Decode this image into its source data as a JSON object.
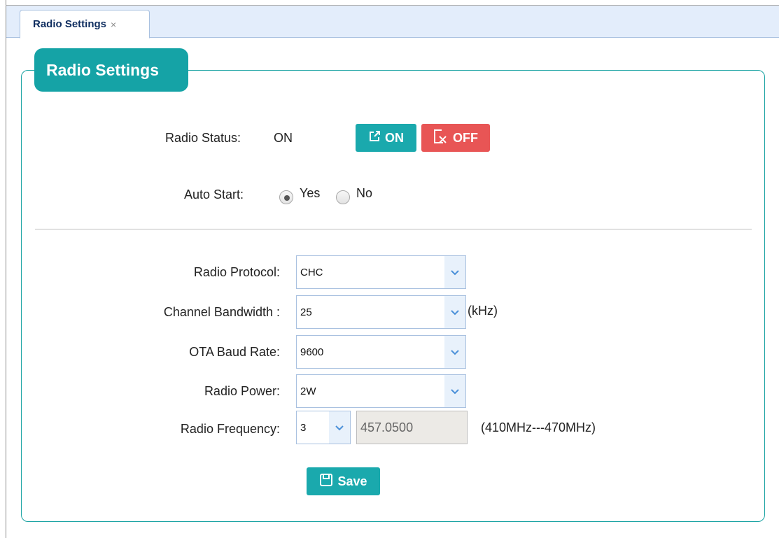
{
  "tab": {
    "title": "Radio Settings",
    "close": "×"
  },
  "panel": {
    "legend": "Radio Settings"
  },
  "status": {
    "label": "Radio Status:",
    "value": "ON",
    "on_button": "ON",
    "off_button": "OFF"
  },
  "auto_start": {
    "label": "Auto Start:",
    "options": [
      "Yes",
      "No"
    ],
    "selected": "Yes"
  },
  "form": {
    "protocol": {
      "label": "Radio Protocol:",
      "value": "CHC"
    },
    "bandwidth": {
      "label": "Channel Bandwidth :",
      "value": "25",
      "unit": "(kHz)"
    },
    "baud": {
      "label": "OTA Baud Rate:",
      "value": "9600"
    },
    "power": {
      "label": "Radio Power:",
      "value": "2W"
    },
    "frequency": {
      "label": "Radio Frequency:",
      "channel": "3",
      "value": "457.0500",
      "range": "(410MHz---470MHz)"
    }
  },
  "save_button": "Save",
  "colors": {
    "accent": "#1aa9ad",
    "danger": "#e85555",
    "tab_bar": "#e3edfb",
    "input_border": "#a9c1e0",
    "chevron": "#4a90d9"
  },
  "icons": {
    "on": "external-link-icon",
    "off": "close-box-icon",
    "save": "floppy-disk-icon",
    "dropdown": "chevron-down-icon"
  }
}
